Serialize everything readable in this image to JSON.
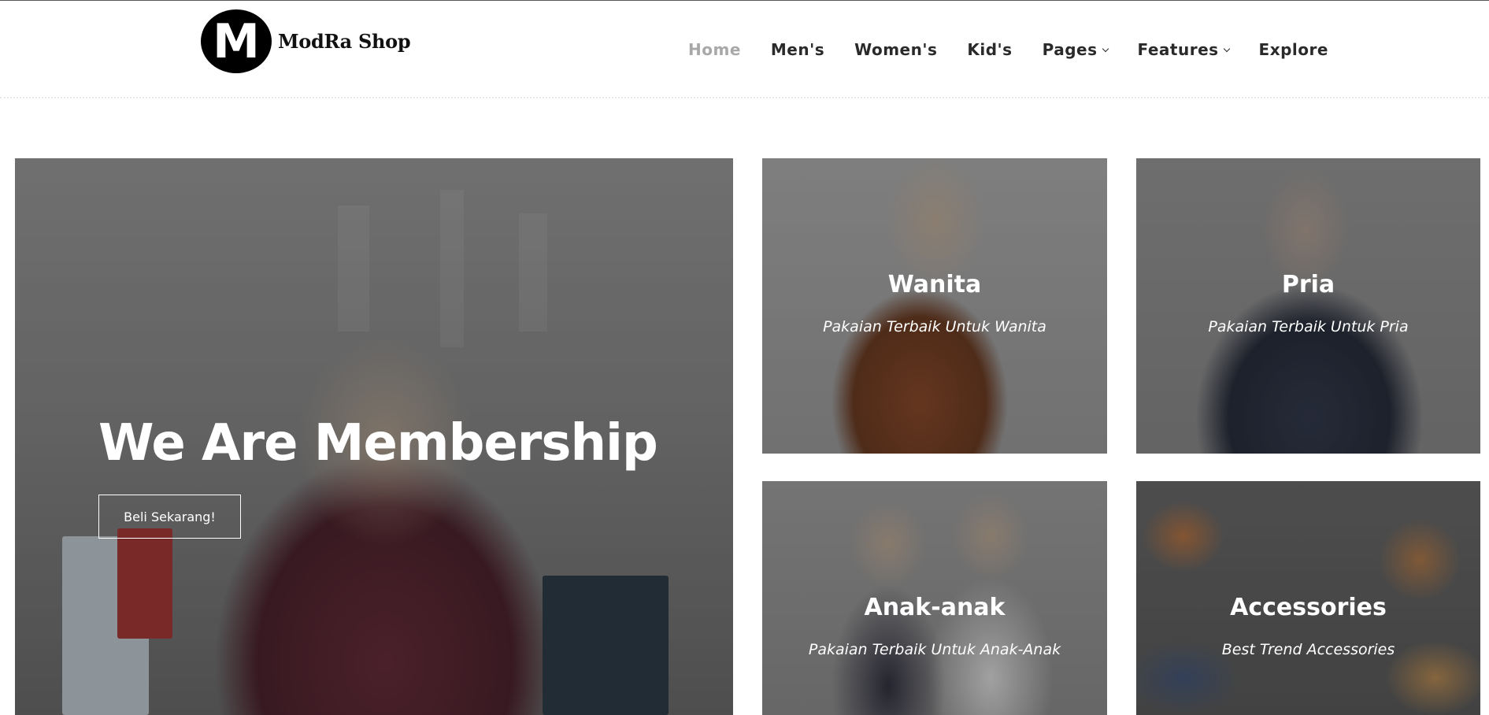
{
  "brand": {
    "logo_letter": "M",
    "name": "ModRa Shop"
  },
  "nav": {
    "items": [
      {
        "label": "Home",
        "active": true
      },
      {
        "label": "Men's"
      },
      {
        "label": "Women's"
      },
      {
        "label": "Kid's"
      },
      {
        "label": "Pages",
        "icon": "chevron-down-icon"
      },
      {
        "label": "Features",
        "icon": "chevron-down-icon"
      },
      {
        "label": "Explore"
      }
    ]
  },
  "hero": {
    "title": "We Are Membership",
    "button_label": "Beli Sekarang!"
  },
  "categories": [
    {
      "title": "Wanita",
      "subtitle": "Pakaian Terbaik Untuk Wanita"
    },
    {
      "title": "Pria",
      "subtitle": "Pakaian Terbaik Untuk Pria"
    },
    {
      "title": "Anak-anak",
      "subtitle": "Pakaian Terbaik Untuk Anak-Anak"
    },
    {
      "title": "Accessories",
      "subtitle": "Best Trend Accessories"
    }
  ],
  "colors": {
    "nav_active": "#a8a8a8",
    "nav_text": "#2a2a2a",
    "overlay_text": "#ffffff"
  }
}
